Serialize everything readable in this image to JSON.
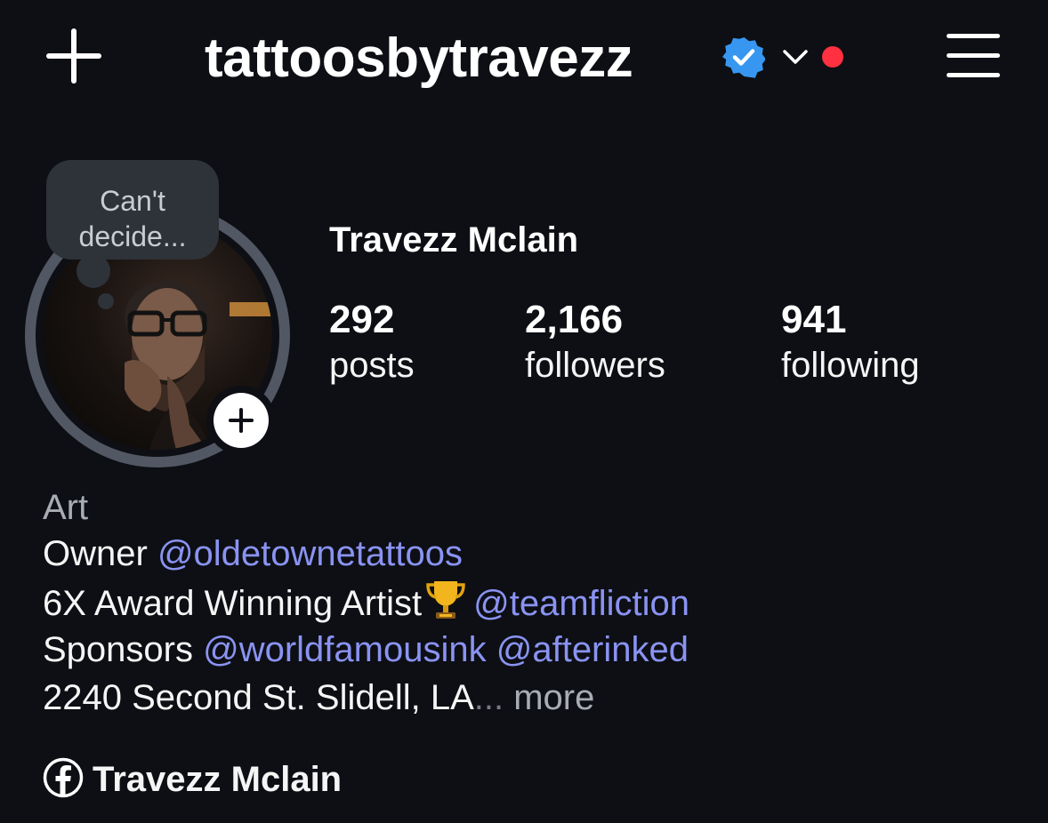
{
  "header": {
    "username": "tattoosbytravezz",
    "accent_verified": "#3797f0",
    "notification_dot_color": "#ff3040",
    "icons": [
      "plus-icon",
      "verified-badge-icon",
      "chevron-down-icon",
      "hamburger-menu-icon"
    ]
  },
  "profile": {
    "note": "Can't decide...",
    "display_name": "Travezz Mclain",
    "stats": [
      {
        "value": "292",
        "label": "posts"
      },
      {
        "value": "2,166",
        "label": "followers"
      },
      {
        "value": "941",
        "label": "following"
      }
    ]
  },
  "bio": {
    "category": "Art",
    "line1_text": "Owner",
    "line1_mention": "@oldetownetattoos",
    "line2_text": "6X Award Winning Artist",
    "line2_emoji": "trophy",
    "line2_mention": "@teamfliction",
    "line3_text": "Sponsors",
    "line3_mention1": "@worldfamousink",
    "line3_mention2": "@afterinked",
    "line4_text": "2240 Second St. Slidell, LA",
    "line4_ellipsis": "...",
    "more_label": "more",
    "mention_color": "#8a93f2"
  },
  "links": {
    "facebook_label": "Travezz Mclain"
  }
}
